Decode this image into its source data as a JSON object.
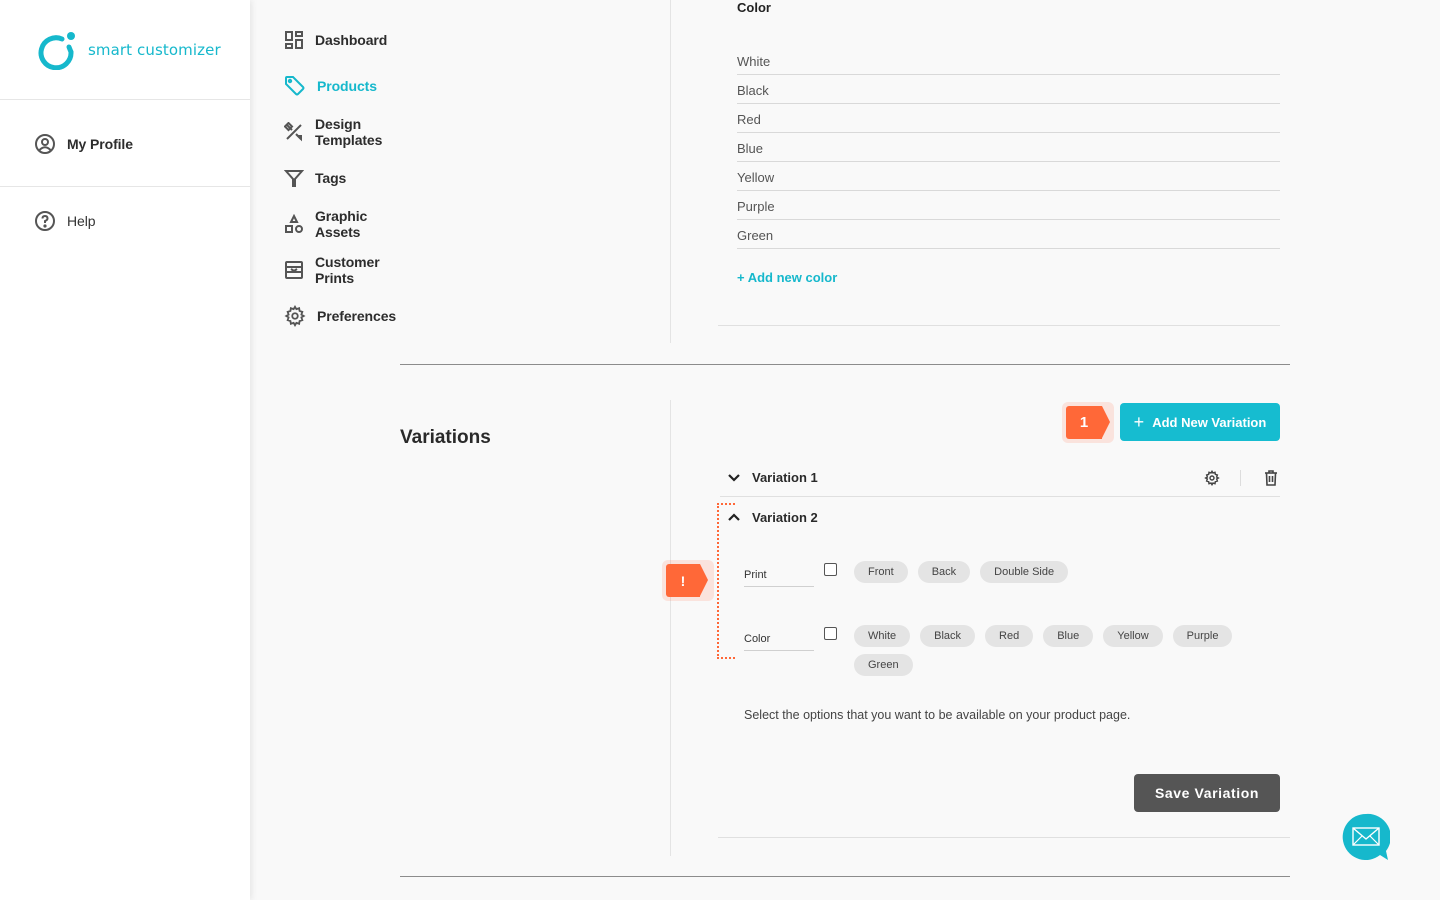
{
  "brand": {
    "name": "smart customizer",
    "accent": "#16b8cc",
    "alert": "#ff6838"
  },
  "sidebar": {
    "profile": {
      "label": "My Profile",
      "icon": "user-circle-icon"
    },
    "items": [
      {
        "label": "Dashboard",
        "icon": "dashboard-icon",
        "active": false
      },
      {
        "label": "Products",
        "icon": "tag-icon",
        "active": true
      },
      {
        "label": "Design Templates",
        "icon": "design-tools-icon",
        "active": false
      },
      {
        "label": "Tags",
        "icon": "filter-icon",
        "active": false
      },
      {
        "label": "Graphic Assets",
        "icon": "shapes-icon",
        "active": false
      },
      {
        "label": "Customer Prints",
        "icon": "prints-icon",
        "active": false
      },
      {
        "label": "Preferences",
        "icon": "gear-icon",
        "active": false
      }
    ],
    "help": {
      "label": "Help",
      "icon": "help-circle-icon"
    }
  },
  "options": {
    "color": {
      "title": "Color",
      "values": [
        "White",
        "Black",
        "Red",
        "Blue",
        "Yellow",
        "Purple",
        "Green"
      ],
      "add_label": "+ Add new color"
    }
  },
  "variations": {
    "title": "Variations",
    "add_button": "Add New Variation",
    "step_badge": "1",
    "warn_badge": "!",
    "list": [
      {
        "label": "Variation 1",
        "expanded": false
      },
      {
        "label": "Variation 2",
        "expanded": true
      }
    ],
    "editor": {
      "rows": [
        {
          "label": "Print",
          "checked": false,
          "chips": [
            "Front",
            "Back",
            "Double Side"
          ]
        },
        {
          "label": "Color",
          "checked": false,
          "chips": [
            "White",
            "Black",
            "Red",
            "Blue",
            "Yellow",
            "Purple",
            "Green"
          ]
        }
      ],
      "hint": "Select the options that you want to be available on your product page.",
      "save_button": "Save Variation"
    }
  },
  "chat": {
    "icon": "mail-chat-icon"
  }
}
